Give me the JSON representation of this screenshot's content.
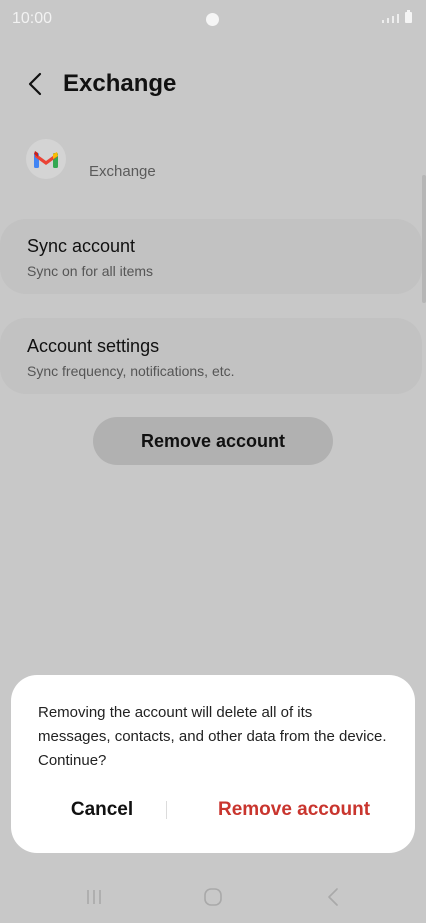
{
  "status_bar": {
    "time": "10:00"
  },
  "header": {
    "title": "Exchange"
  },
  "account": {
    "name": "Exchange",
    "icon": "gmail-icon"
  },
  "cards": [
    {
      "title": "Sync account",
      "subtitle": "Sync on for all items"
    },
    {
      "title": "Account settings",
      "subtitle": "Sync frequency, notifications, etc."
    }
  ],
  "remove_button": {
    "label": "Remove account"
  },
  "dialog": {
    "message": "Removing the account will delete all of its messages, contacts, and other data from the device. Continue?",
    "cancel_label": "Cancel",
    "confirm_label": "Remove account",
    "confirm_color": "#c9352e"
  },
  "nav": {
    "icons": [
      "recent-apps-icon",
      "home-icon",
      "back-icon"
    ]
  }
}
